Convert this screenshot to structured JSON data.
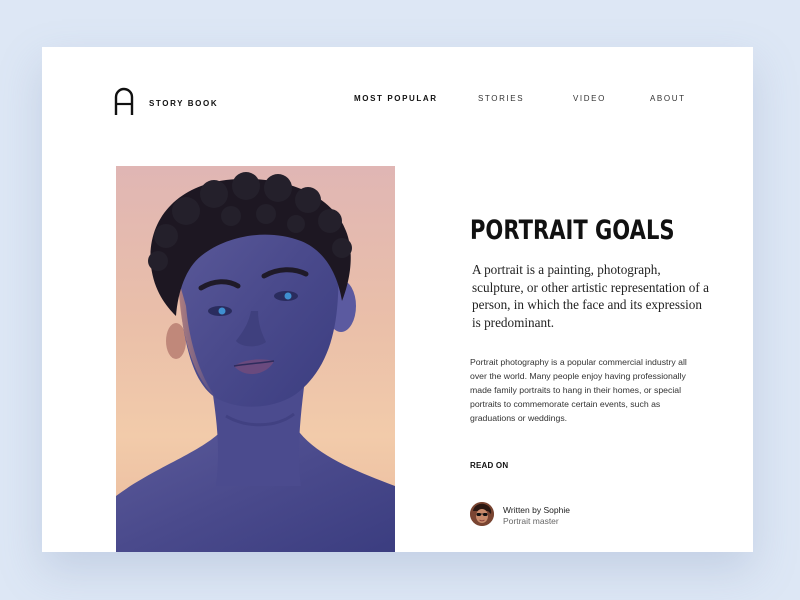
{
  "header": {
    "logo_icon": "letter-a-arch-logo",
    "brand": "STORY BOOK"
  },
  "nav": {
    "items": [
      {
        "label": "MOST POPULAR",
        "active": true
      },
      {
        "label": "STORIES",
        "active": false
      },
      {
        "label": "VIDEO",
        "active": false
      },
      {
        "label": "ABOUT",
        "active": false
      }
    ]
  },
  "hero": {
    "image": "portrait-photo",
    "title": "PORTRAIT GOALS",
    "lead": "A portrait is a painting, photograph, sculpture, or other artistic representation of a person, in which the face and its expression is predominant.",
    "body": "Portrait photography is a popular commercial industry all over the world. Many people enjoy having professionally made family portraits to hang in their homes, or special portraits to commemorate certain events, such as graduations or weddings.",
    "cta": "READ ON"
  },
  "author": {
    "name": "Written by Sophie",
    "role": "Portrait master"
  },
  "colors": {
    "background": "#dde7f5",
    "card": "#ffffff",
    "text": "#111111"
  }
}
